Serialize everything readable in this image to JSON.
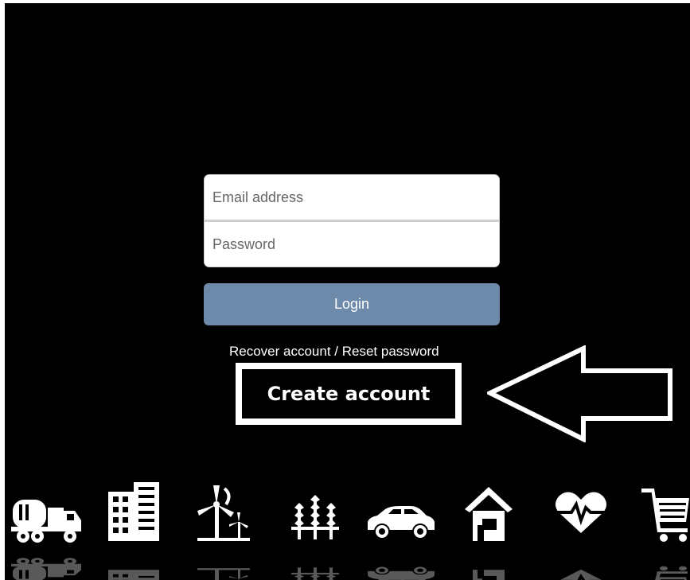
{
  "login": {
    "email_placeholder": "Email address",
    "password_placeholder": "Password",
    "login_label": "Login"
  },
  "links": {
    "recover": "Recover account / Reset password",
    "create": "Create account"
  },
  "colors": {
    "background": "#000000",
    "login_button": "#6e8aaa",
    "text": "#ffffff"
  },
  "category_icons": [
    "cement-truck-icon",
    "building-icon",
    "wind-turbine-icon",
    "wheat-icon",
    "car-icon",
    "house-icon",
    "health-heart-icon",
    "shopping-cart-icon"
  ]
}
